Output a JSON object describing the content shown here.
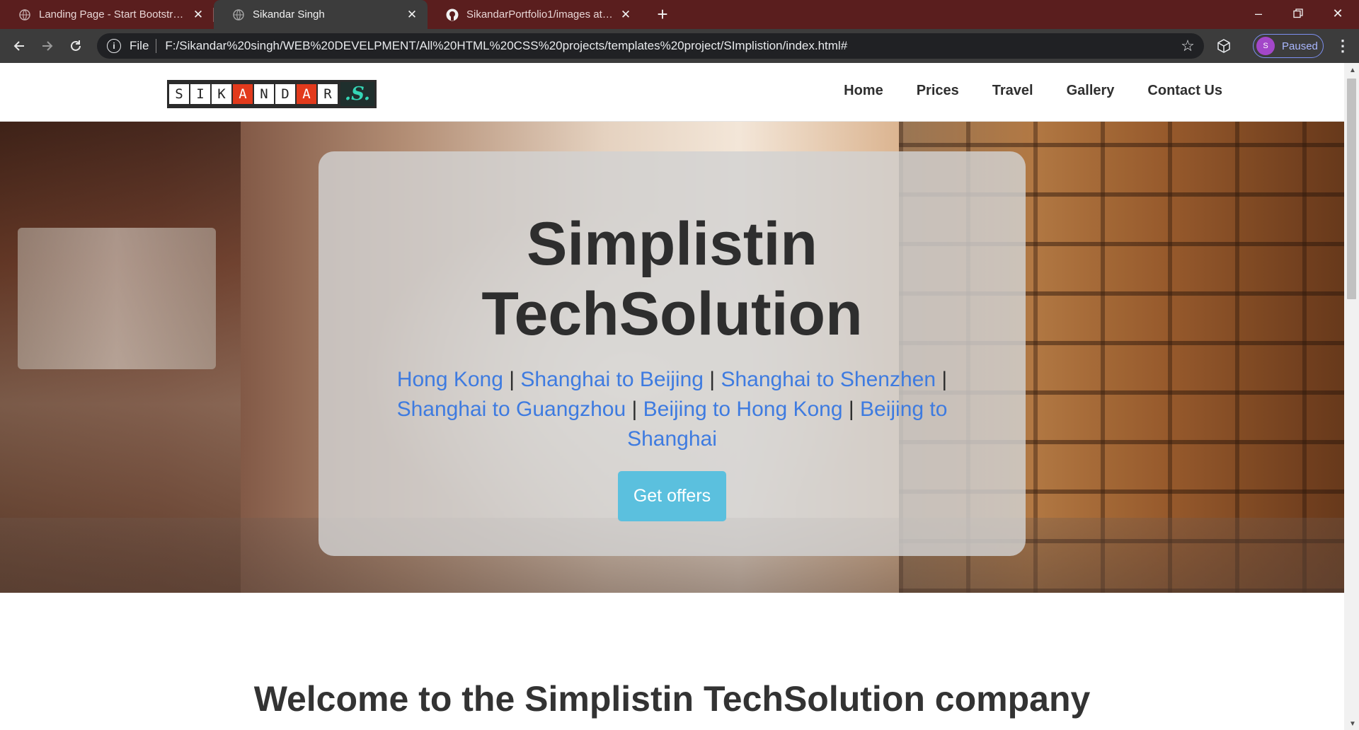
{
  "browser": {
    "tabs": [
      {
        "title": "Landing Page - Start Bootstrap Theme",
        "active": false,
        "favicon": "globe-icon"
      },
      {
        "title": "Sikandar Singh",
        "active": true,
        "favicon": "globe-icon"
      },
      {
        "title": "SikandarPortfolio1/images at master",
        "active": false,
        "favicon": "github-icon"
      }
    ],
    "new_tab": "+",
    "address": {
      "scheme_label": "File",
      "url": "F:/Sikandar%20singh/WEB%20DEVELPMENT/All%20HTML%20CSS%20projects/templates%20project/SImplistion/index.html#"
    },
    "profile": {
      "initial": "S",
      "status": "Paused"
    },
    "theme_color": "#5a1e1e"
  },
  "site": {
    "logo": {
      "letters": [
        "S",
        "I",
        "K",
        "A",
        "N",
        "D",
        "A",
        "R"
      ],
      "mark": ".S."
    },
    "nav": [
      "Home",
      "Prices",
      "Travel",
      "Gallery",
      "Contact Us"
    ],
    "hero": {
      "title_line1": "Simplistin",
      "title_line2": "TechSolution",
      "routes": [
        "Hong Kong",
        "Shanghai to Beijing",
        "Shanghai to Shenzhen",
        "Shanghai to Guangzhou",
        "Beijing to Hong Kong",
        "Beijing to Shanghai"
      ],
      "separator": "|",
      "cta": "Get offers",
      "route_color": "#3e7be0",
      "cta_color": "#5bc0de"
    },
    "welcome_heading": "Welcome to the Simplistin TechSolution company"
  }
}
